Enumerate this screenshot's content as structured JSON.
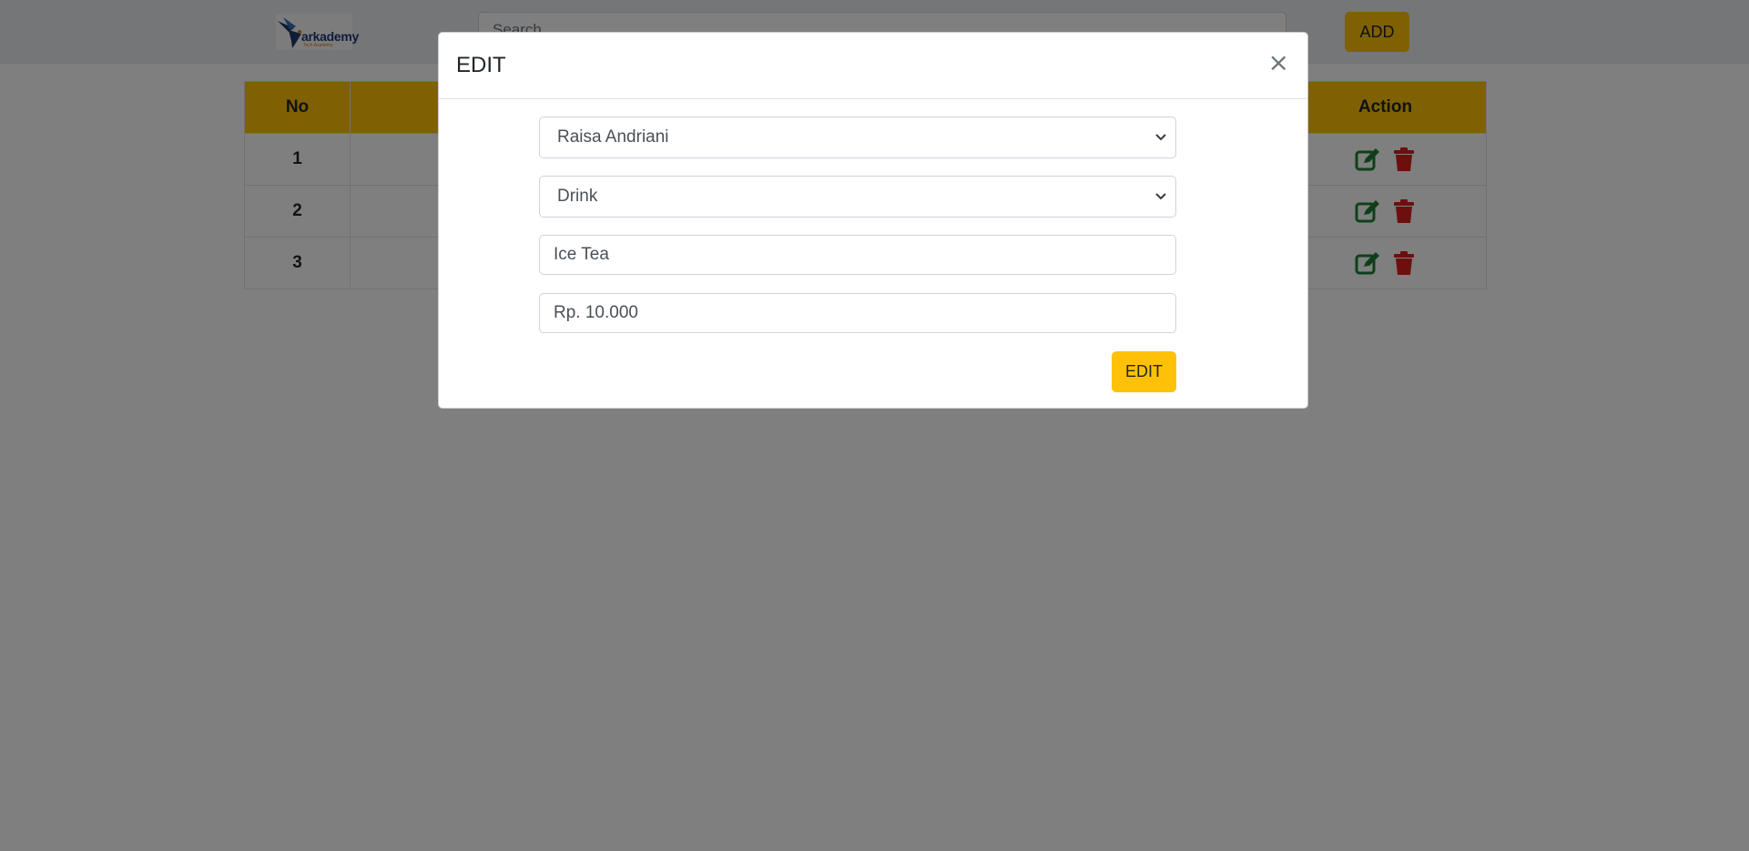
{
  "navbar": {
    "logo_text": "arkademy",
    "logo_sub": "Tech Academy",
    "search_placeholder": "Search",
    "add_label": "ADD"
  },
  "table": {
    "headers": {
      "no": "No",
      "action": "Action"
    },
    "rows": [
      {
        "no": "1"
      },
      {
        "no": "2"
      },
      {
        "no": "3"
      }
    ]
  },
  "modal": {
    "title": "EDIT",
    "close": "×",
    "cashier_select": "Raisa Andriani",
    "category_select": "Drink",
    "name_value": "Ice Tea",
    "price_value": "Rp. 10.000",
    "submit_label": "EDIT"
  },
  "colors": {
    "accent": "#ffc107",
    "edit_icon": "#1e7e34",
    "delete_icon": "#dc1f1f"
  },
  "icons": [
    "edit-icon",
    "trash-icon",
    "close-icon",
    "chevron-down-icon"
  ]
}
